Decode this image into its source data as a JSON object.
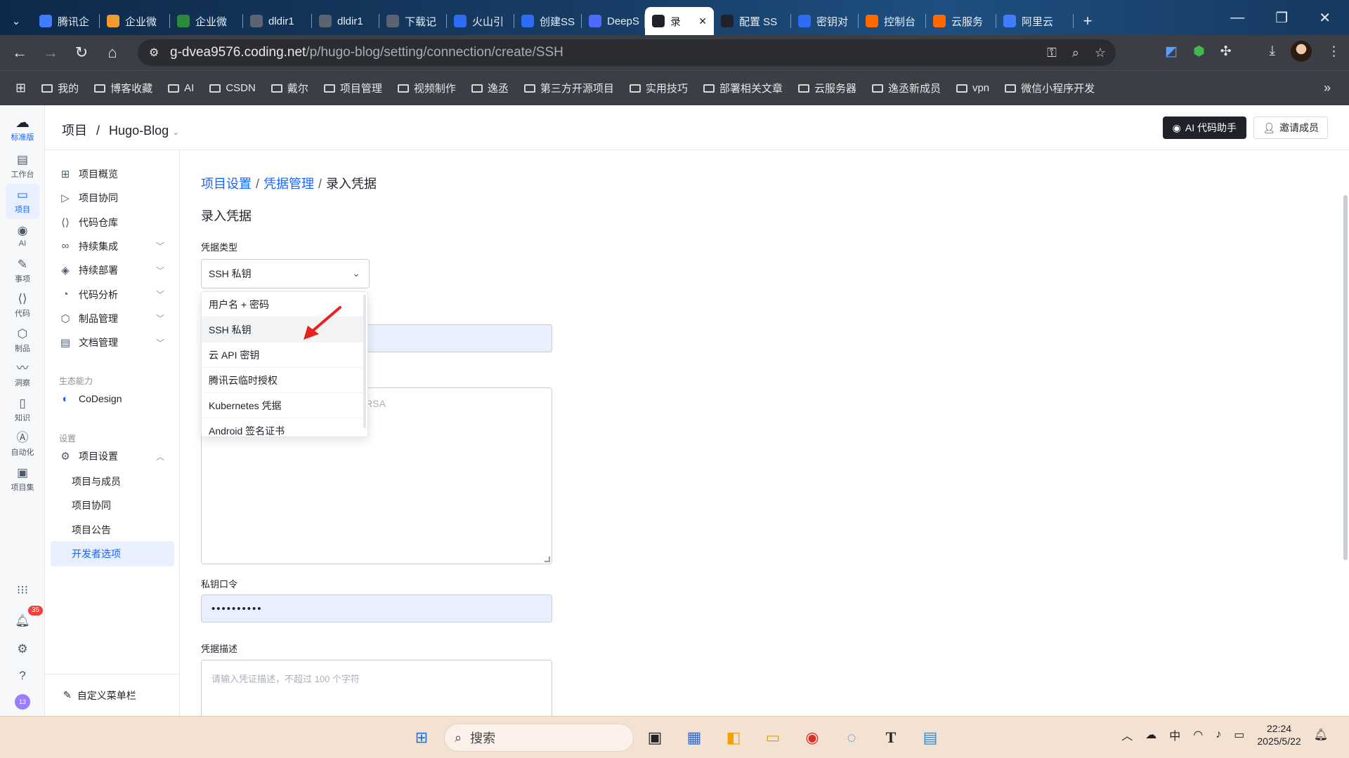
{
  "browser": {
    "tabs": [
      {
        "label": "腾讯企",
        "color": "#3f7cff",
        "icon": "tencent-icon"
      },
      {
        "label": "企业微",
        "color": "#f29b30",
        "icon": "wework-icon"
      },
      {
        "label": "企业微",
        "color": "#2c8a3b",
        "icon": "wework-green-icon"
      },
      {
        "label": "dldir1",
        "color": "#5b6470",
        "icon": "globe-icon"
      },
      {
        "label": "dldir1",
        "color": "#5b6470",
        "icon": "globe-icon"
      },
      {
        "label": "下载记",
        "color": "#5b6470",
        "icon": "download-icon"
      },
      {
        "label": "火山引",
        "color": "#2f6cf6",
        "icon": "volcano-icon"
      },
      {
        "label": "创建SS",
        "color": "#2f6cf6",
        "icon": "volcano-icon"
      },
      {
        "label": "DeepS",
        "color": "#4d6bfe",
        "icon": "deepseek-icon"
      },
      {
        "label": "录",
        "color": "#1f2329",
        "icon": "coding-icon",
        "active": true
      },
      {
        "label": "配置 SS",
        "color": "#1f2329",
        "icon": "coding-icon"
      },
      {
        "label": "密钥对",
        "color": "#2f6cf6",
        "icon": "volcano-icon"
      },
      {
        "label": "控制台",
        "color": "#ff6a00",
        "icon": "aliyun-icon"
      },
      {
        "label": "云服务",
        "color": "#ff6a00",
        "icon": "aliyun-icon"
      },
      {
        "label": "阿里云",
        "color": "#3f7cff",
        "icon": "tencent-icon"
      }
    ],
    "url_host": "g-dvea9576.coding.net",
    "url_path": "/p/hugo-blog/setting/connection/create/SSH",
    "bookmarks": [
      "我的",
      "博客收藏",
      "AI",
      "CSDN",
      "戴尔",
      "项目管理",
      "视频制作",
      "逸丞",
      "第三方开源项目",
      "实用技巧",
      "部署相关文章",
      "云服务器",
      "逸丞新成员",
      "vpn",
      "微信小程序开发"
    ]
  },
  "rail": {
    "edition": "标准版",
    "items": [
      {
        "label": "工作台",
        "icon": "dashboard-icon"
      },
      {
        "label": "项目",
        "icon": "project-icon",
        "active": true
      },
      {
        "label": "AI",
        "icon": "ai-icon"
      },
      {
        "label": "事项",
        "icon": "issue-icon"
      },
      {
        "label": "代码",
        "icon": "code-icon"
      },
      {
        "label": "制品",
        "icon": "artifact-icon"
      },
      {
        "label": "洞察",
        "icon": "insight-icon"
      },
      {
        "label": "知识",
        "icon": "knowledge-icon"
      },
      {
        "label": "自动化",
        "icon": "automation-icon"
      },
      {
        "label": "项目集",
        "icon": "program-icon"
      }
    ],
    "notif_count": "35",
    "user_badge": "13"
  },
  "topbar": {
    "root": "项目",
    "project": "Hugo-Blog",
    "ai_button": "AI 代码助手",
    "invite_button": "邀请成员"
  },
  "menu": {
    "items": [
      {
        "label": "项目概览",
        "icon": "grid-icon"
      },
      {
        "label": "项目协同",
        "icon": "play-icon"
      },
      {
        "label": "代码仓库",
        "icon": "code-icon"
      },
      {
        "label": "持续集成",
        "icon": "ci-icon",
        "expand": true
      },
      {
        "label": "持续部署",
        "icon": "deploy-icon",
        "expand": true
      },
      {
        "label": "代码分析",
        "icon": "analysis-icon",
        "expand": true
      },
      {
        "label": "制品管理",
        "icon": "box-icon",
        "expand": true
      },
      {
        "label": "文档管理",
        "icon": "doc-icon",
        "expand": true
      }
    ],
    "group_eco": "生态能力",
    "codesign": "CoDesign",
    "group_settings": "设置",
    "settings": "项目设置",
    "settings_sub": [
      "项目与成员",
      "项目协同",
      "项目公告",
      "开发者选项"
    ],
    "customize": "自定义菜单栏"
  },
  "main": {
    "crumb": [
      "项目设置",
      "凭据管理",
      "录入凭据"
    ],
    "title": "录入凭据",
    "type_label": "凭据类型",
    "type_value": "SSH 私钥",
    "options": [
      "用户名 + 密码",
      "SSH 私钥",
      "云 API 密钥",
      "腾讯云临时授权",
      "Kubernetes 凭据",
      "Android 签名证书"
    ],
    "key_placeholder": "GIN RSA PRIVATE KEY-开头,END RSA",
    "pass_label": "私钥口令",
    "pass_value": "••••••••••",
    "desc_label": "凭据描述",
    "desc_placeholder": "请输入凭证描述，不超过 100 个字符"
  },
  "taskbar": {
    "search": "搜索",
    "ime": "中",
    "time": "22:24",
    "date": "2025/5/22"
  }
}
